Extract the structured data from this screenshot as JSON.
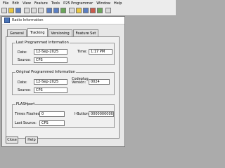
{
  "menu": [
    "File",
    "Edit",
    "View",
    "Feature",
    "Tools",
    "P25 Programmer",
    "Window",
    "Help"
  ],
  "dialog": {
    "title": "Radio Information"
  },
  "tabs": [
    "General",
    "Tracking",
    "Versioning",
    "Feature Set"
  ],
  "last_programmed": {
    "title": "Last Programmed Information",
    "date_label": "Date:",
    "date": "12-Sep-2025",
    "time_label": "Time:",
    "time": "1:17 PM",
    "source_label": "Source:",
    "source": "CPS"
  },
  "original_programmed": {
    "title": "Original Programmed Information",
    "date_label": "Date:",
    "date": "12-Sep-2025",
    "codeplug_label": "Codeplug Version:",
    "codeplug_version": "0024",
    "source_label": "Source:",
    "source": "CPS"
  },
  "flashport": {
    "title": "FLASHport",
    "times_flashed_label": "Times Flashed:",
    "times_flashed": "0",
    "ibutton_label": "I-Button:",
    "ibutton": "000000000000",
    "last_source_label": "Last Source:",
    "last_source": "CPS"
  },
  "buttons": {
    "close": "Close",
    "help": "Help"
  }
}
